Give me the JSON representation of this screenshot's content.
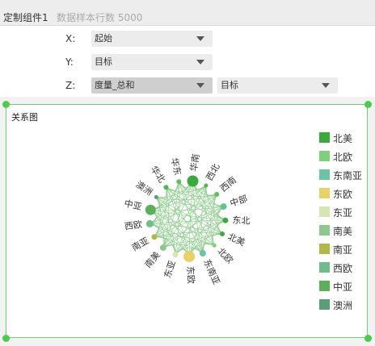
{
  "header": {
    "title": "定制组件1",
    "subtitle": "数据样本行数 5000"
  },
  "config": {
    "x": {
      "label": "X:",
      "value": "起始"
    },
    "y": {
      "label": "Y:",
      "value": "目标"
    },
    "z": {
      "label": "Z:",
      "value": "度量_总和",
      "value2": "目标"
    }
  },
  "chart_data": {
    "type": "graph",
    "title": "关系图",
    "nodes": [
      {
        "name": "华南",
        "color": "#3aaa3a"
      },
      {
        "name": "西北",
        "color": "#4cb84c"
      },
      {
        "name": "西南",
        "color": "#5cbf5c"
      },
      {
        "name": "中部",
        "color": "#6abf8e"
      },
      {
        "name": "东北",
        "color": "#3aaa3a"
      },
      {
        "name": "北美",
        "color": "#3aaa3a"
      },
      {
        "name": "北欧",
        "color": "#7dd17d"
      },
      {
        "name": "东南亚",
        "color": "#6bc4a6"
      },
      {
        "name": "东欧",
        "color": "#e8d266"
      },
      {
        "name": "东亚",
        "color": "#d6e6b0"
      },
      {
        "name": "南美",
        "color": "#8fc88f"
      },
      {
        "name": "南亚",
        "color": "#b0b848"
      },
      {
        "name": "西欧",
        "color": "#6ebd8a"
      },
      {
        "name": "中亚",
        "color": "#5cb05c"
      },
      {
        "name": "澳洲",
        "color": "#5a9e78"
      },
      {
        "name": "华北",
        "color": "#4cb84c"
      },
      {
        "name": "华东",
        "color": "#5cbf5c"
      }
    ],
    "legend": [
      {
        "name": "北美",
        "color": "#3aaa3a"
      },
      {
        "name": "北欧",
        "color": "#7dd17d"
      },
      {
        "name": "东南亚",
        "color": "#6bc4a6"
      },
      {
        "name": "东欧",
        "color": "#e8d266"
      },
      {
        "name": "东亚",
        "color": "#d6e6b0"
      },
      {
        "name": "南美",
        "color": "#8fc88f"
      },
      {
        "name": "南亚",
        "color": "#b0b848"
      },
      {
        "name": "西欧",
        "color": "#6ebd8a"
      },
      {
        "name": "中亚",
        "color": "#5cb05c"
      },
      {
        "name": "澳洲",
        "color": "#5a9e78"
      }
    ]
  }
}
